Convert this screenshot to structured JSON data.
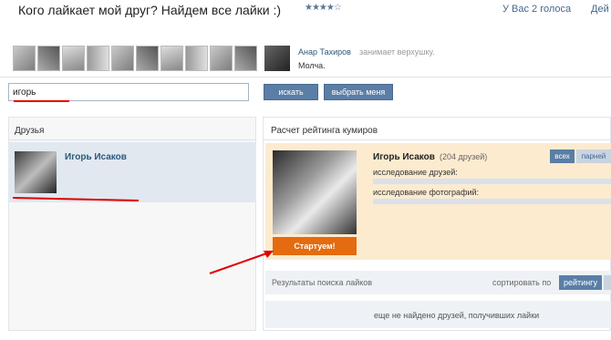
{
  "header": {
    "title": "Кого лайкает мой друг? Найдем все лайки :)",
    "stars": "★★★★☆",
    "votes": "У Вас 2 голоса",
    "actions_label": "Дей"
  },
  "feed": {
    "author": "Анар Тахиров",
    "action": "занимает верхушку.",
    "text": "Молча."
  },
  "search": {
    "value": "игорь",
    "search_button": "искать",
    "choose_button": "выбрать меня"
  },
  "friends_panel": {
    "title": "Друзья",
    "items": [
      {
        "name": "Игорь Исаков"
      }
    ]
  },
  "rating_panel": {
    "title": "Расчет рейтинга кумиров",
    "card": {
      "name": "Игорь Исаков",
      "friends": "(204 друзей)",
      "stat_friends": "исследование друзей:",
      "stat_photos": "исследование фотографий:",
      "start_button": "Стартуем!",
      "filter_all": "всех",
      "filter_guys": "парней"
    },
    "results": {
      "label": "Результаты поиска лайков",
      "sort_label": "сортировать по",
      "sort_rating": "рейтингу",
      "empty": "еще не найдено друзей, получивших лайки"
    }
  },
  "colors": {
    "accent": "#5a7ea6",
    "link": "#2b587a",
    "start": "#e46b10",
    "card_bg": "#fcebcf",
    "annotation": "#e00000"
  }
}
